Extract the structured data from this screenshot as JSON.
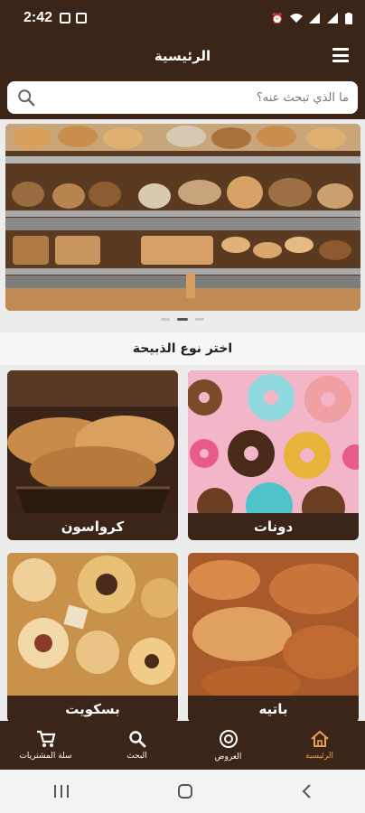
{
  "status_bar": {
    "time": "2:42"
  },
  "header": {
    "title": "الرئيسية"
  },
  "search": {
    "placeholder": "ما الذي تبحث عنه؟"
  },
  "section": {
    "title": "اختر نوع الذبيحة"
  },
  "categories": [
    {
      "label": "دونات"
    },
    {
      "label": "كرواسون"
    },
    {
      "label": "باتيه"
    },
    {
      "label": "بسكويت"
    }
  ],
  "bottom_nav": {
    "home": "الرئيسية",
    "offers": "العروض",
    "search": "البحث",
    "cart": "سلة المشتريات"
  },
  "colors": {
    "primary": "#3b2418",
    "accent": "#e6a34a"
  }
}
